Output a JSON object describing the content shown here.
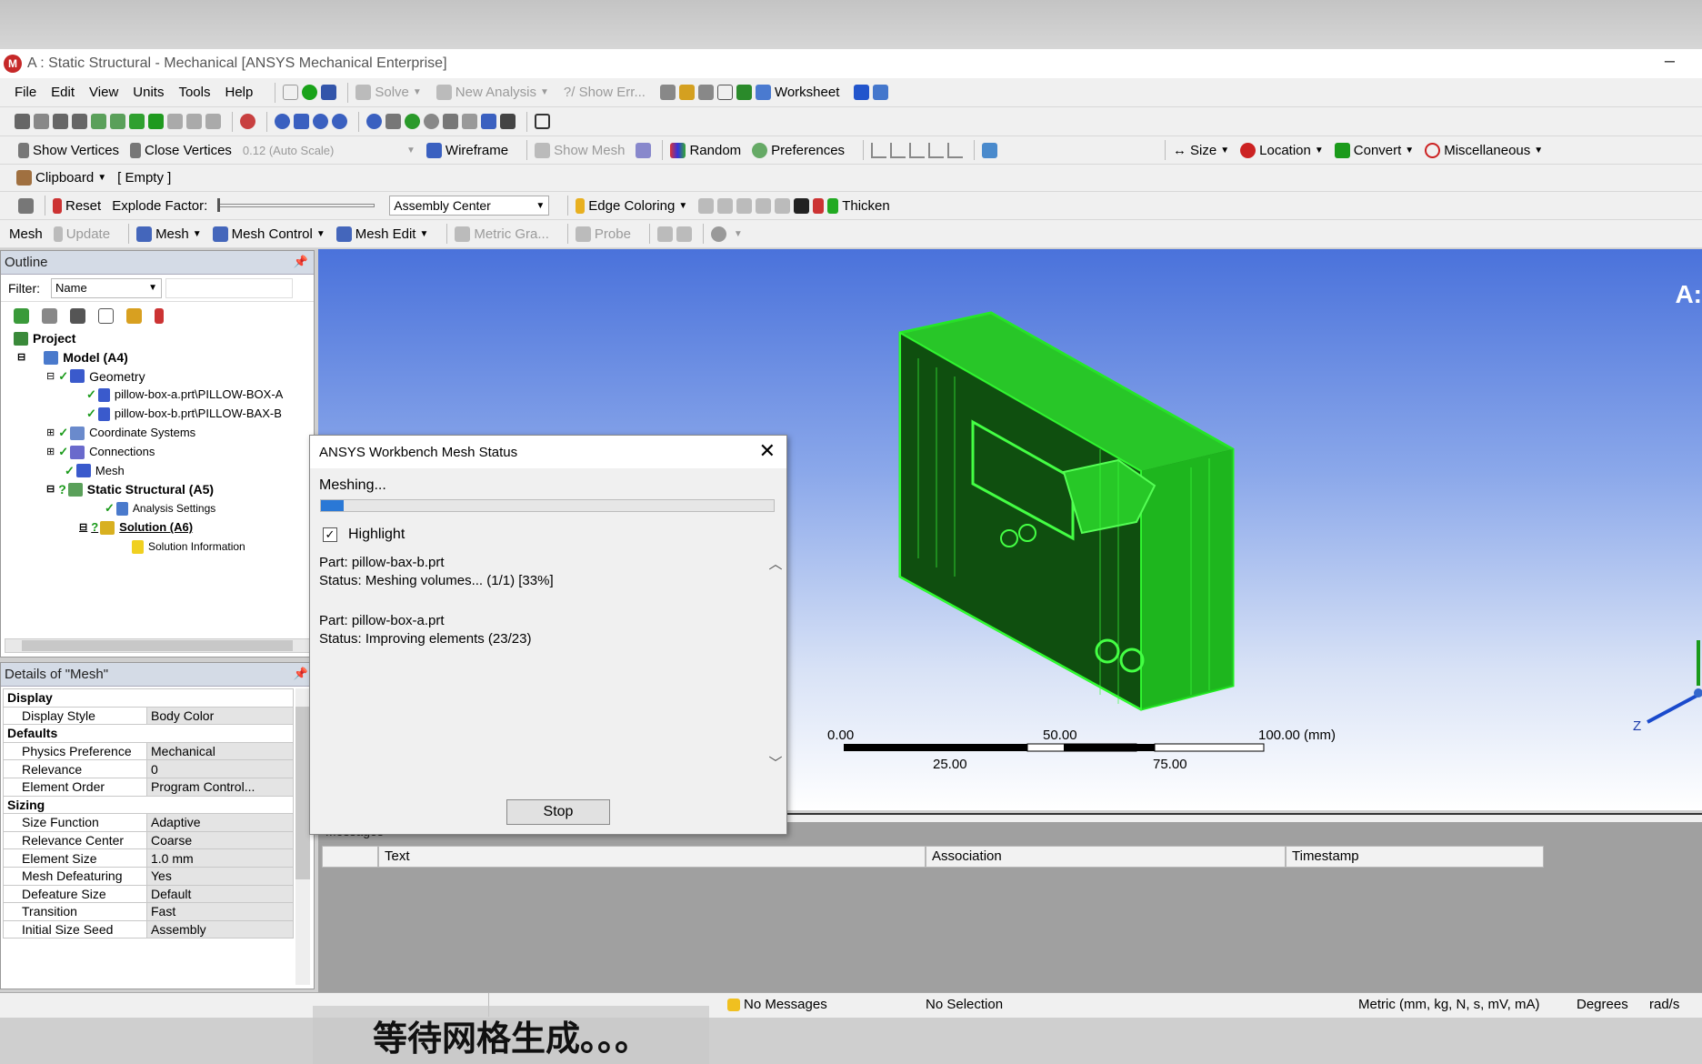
{
  "window": {
    "title": "A : Static Structural - Mechanical [ANSYS Mechanical Enterprise]",
    "app_icon": "M"
  },
  "menu": [
    "File",
    "Edit",
    "View",
    "Units",
    "Tools",
    "Help"
  ],
  "toolbar1": {
    "solve": "Solve",
    "new_analysis": "New Analysis",
    "show_errors": "?/ Show Err...",
    "worksheet": "Worksheet"
  },
  "toolbar3": {
    "show_vertices": "Show Vertices",
    "close_vertices": "Close Vertices",
    "scale": "0.12 (Auto Scale)",
    "wireframe": "Wireframe",
    "show_mesh": "Show Mesh",
    "random": "Random",
    "preferences": "Preferences",
    "size": "Size",
    "location": "Location",
    "convert": "Convert",
    "miscellaneous": "Miscellaneous"
  },
  "toolbar4": {
    "clipboard": "Clipboard",
    "empty": "[ Empty ]"
  },
  "toolbar5": {
    "reset": "Reset",
    "explode_factor": "Explode Factor:",
    "assembly_center": "Assembly Center",
    "edge_coloring": "Edge Coloring",
    "thicken": "Thicken"
  },
  "toolbar6": {
    "mesh": "Mesh",
    "update": "Update",
    "mesh_menu": "Mesh",
    "mesh_control": "Mesh Control",
    "mesh_edit": "Mesh Edit",
    "metric_graph": "Metric Gra...",
    "probe": "Probe"
  },
  "outline": {
    "title": "Outline",
    "filter_label": "Filter:",
    "filter_value": "Name",
    "tree": [
      "Project",
      "Model (A4)",
      "Geometry",
      "pillow-box-a.prt\\PILLOW-BOX-A",
      "pillow-box-b.prt\\PILLOW-BAX-B",
      "Coordinate Systems",
      "Connections",
      "Mesh",
      "Static Structural (A5)",
      "Analysis Settings",
      "Solution (A6)",
      "Solution Information"
    ]
  },
  "details": {
    "title": "Details of \"Mesh\"",
    "rows": [
      {
        "group": "Display"
      },
      {
        "k": "Display Style",
        "v": "Body Color"
      },
      {
        "group": "Defaults"
      },
      {
        "k": "Physics Preference",
        "v": "Mechanical"
      },
      {
        "k": "Relevance",
        "v": "0"
      },
      {
        "k": "Element Order",
        "v": "Program Control..."
      },
      {
        "group": "Sizing"
      },
      {
        "k": "Size Function",
        "v": "Adaptive"
      },
      {
        "k": "Relevance Center",
        "v": "Coarse"
      },
      {
        "k": "Element Size",
        "v": "1.0 mm"
      },
      {
        "k": "Mesh Defeaturing",
        "v": "Yes"
      },
      {
        "k": "Defeature Size",
        "v": "Default"
      },
      {
        "k": "Transition",
        "v": "Fast"
      },
      {
        "k": "Initial Size Seed",
        "v": "Assembly"
      }
    ]
  },
  "viewport": {
    "corner_text": "A:",
    "scale_top": [
      "0.00",
      "50.00",
      "100.00 (mm)"
    ],
    "scale_bottom": [
      "25.00",
      "75.00"
    ],
    "axis_label": "Z",
    "model_color": "#22ee22"
  },
  "dialog": {
    "title": "ANSYS Workbench Mesh Status",
    "status": "Meshing...",
    "progress": 0.05,
    "highlight_label": "Highlight",
    "highlight_checked": true,
    "part1_label": "Part: pillow-bax-b.prt",
    "part1_status": "Status: Meshing volumes... (1/1) [33%]",
    "part2_label": "Part: pillow-box-a.prt",
    "part2_status": "Status: Improving elements (23/23)",
    "stop": "Stop"
  },
  "messages": {
    "label": "Messages",
    "columns": [
      "Text",
      "Association",
      "Timestamp"
    ]
  },
  "statusbar": {
    "messages": "No Messages",
    "selection": "No Selection",
    "units": "Metric (mm, kg, N, s, mV, mA)",
    "degrees": "Degrees",
    "rads": "rad/s"
  },
  "subtitle": "等待网格生成。。。"
}
